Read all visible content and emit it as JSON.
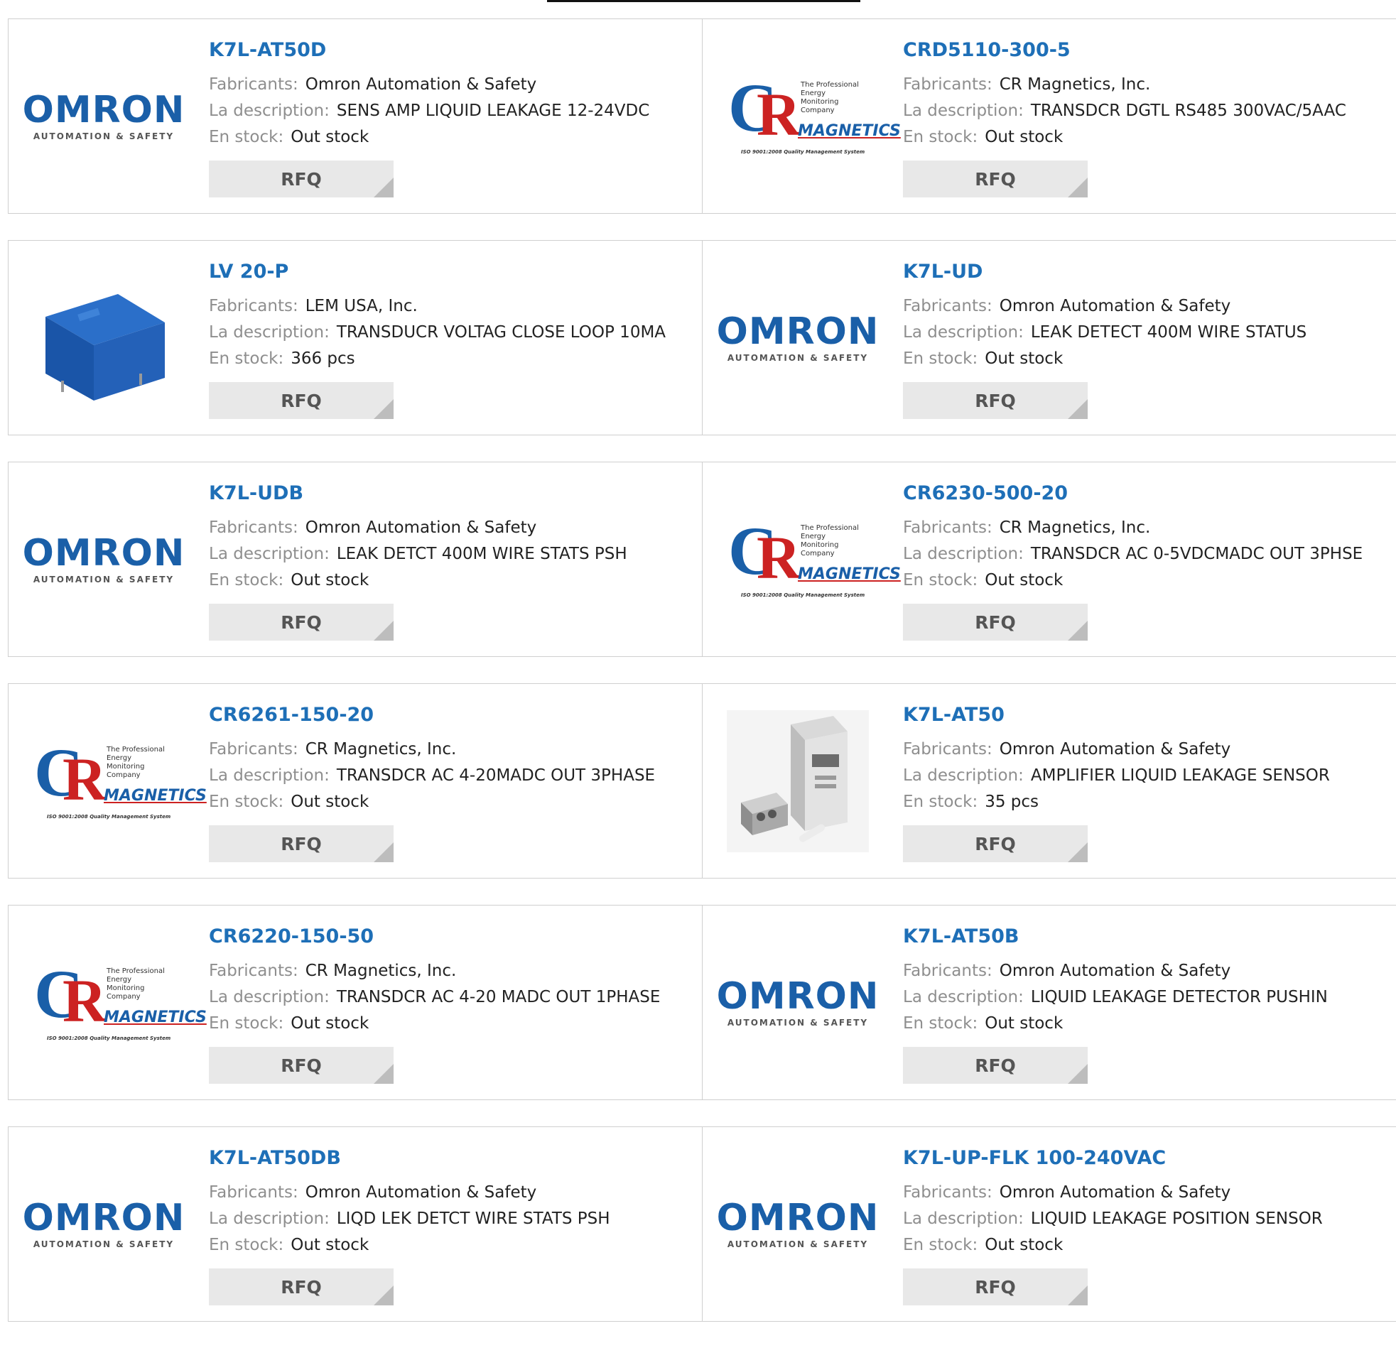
{
  "labels": {
    "manufacturer": "Fabricants:",
    "description": "La description:",
    "stock": "En stock:",
    "rfq": "RFQ"
  },
  "logos": {
    "omron": {
      "word": "OMRON",
      "sub": "AUTOMATION & SAFETY",
      "color": "#1a5fa8"
    },
    "cr": {
      "c": "C",
      "r": "R",
      "tag": "The Professional Energy Monitoring Company",
      "mag": "MAGNETICS",
      "iso": "ISO 9001:2008 Quality Management System"
    }
  },
  "products": [
    {
      "pn": "K7L-AT50D",
      "manufacturer": "Omron Automation & Safety",
      "description": "SENS AMP LIQUID LEAKAGE 12-24VDC",
      "stock": "Out stock",
      "image": "omron-logo"
    },
    {
      "pn": "CRD5110-300-5",
      "manufacturer": "CR Magnetics, Inc.",
      "description": "TRANSDCR DGTL RS485 300VAC/5AAC",
      "stock": "Out stock",
      "image": "cr-magnetics-logo"
    },
    {
      "pn": "LV 20-P",
      "manufacturer": "LEM USA, Inc.",
      "description": "TRANSDUCR VOLTAG CLOSE LOOP 10MA",
      "stock": "366 pcs",
      "image": "blue-transducer-photo"
    },
    {
      "pn": "K7L-UD",
      "manufacturer": "Omron Automation & Safety",
      "description": "LEAK DETECT 400M WIRE STATUS",
      "stock": "Out stock",
      "image": "omron-logo"
    },
    {
      "pn": "K7L-UDB",
      "manufacturer": "Omron Automation & Safety",
      "description": "LEAK DETCT 400M WIRE STATS PSH",
      "stock": "Out stock",
      "image": "omron-logo"
    },
    {
      "pn": "CR6230-500-20",
      "manufacturer": "CR Magnetics, Inc.",
      "description": "TRANSDCR AC 0-5VDCMADC OUT 3PHSE",
      "stock": "Out stock",
      "image": "cr-magnetics-logo"
    },
    {
      "pn": "CR6261-150-20",
      "manufacturer": "CR Magnetics, Inc.",
      "description": "TRANSDCR AC 4-20MADC OUT 3PHASE",
      "stock": "Out stock",
      "image": "cr-magnetics-logo"
    },
    {
      "pn": "K7L-AT50",
      "manufacturer": "Omron Automation & Safety",
      "description": "AMPLIFIER LIQUID LEAKAGE SENSOR",
      "stock": "35 pcs",
      "image": "amplifier-sensor-photo"
    },
    {
      "pn": "CR6220-150-50",
      "manufacturer": "CR Magnetics, Inc.",
      "description": "TRANSDCR AC 4-20 MADC OUT 1PHASE",
      "stock": "Out stock",
      "image": "cr-magnetics-logo"
    },
    {
      "pn": "K7L-AT50B",
      "manufacturer": "Omron Automation & Safety",
      "description": "LIQUID LEAKAGE DETECTOR PUSHIN",
      "stock": "Out stock",
      "image": "omron-logo"
    },
    {
      "pn": "K7L-AT50DB",
      "manufacturer": "Omron Automation & Safety",
      "description": "LIQD LEK DETCT WIRE STATS PSH",
      "stock": "Out stock",
      "image": "omron-logo"
    },
    {
      "pn": "K7L-UP-FLK 100-240VAC",
      "manufacturer": "Omron Automation & Safety",
      "description": "LIQUID LEAKAGE POSITION SENSOR",
      "stock": "Out stock",
      "image": "omron-logo"
    }
  ]
}
